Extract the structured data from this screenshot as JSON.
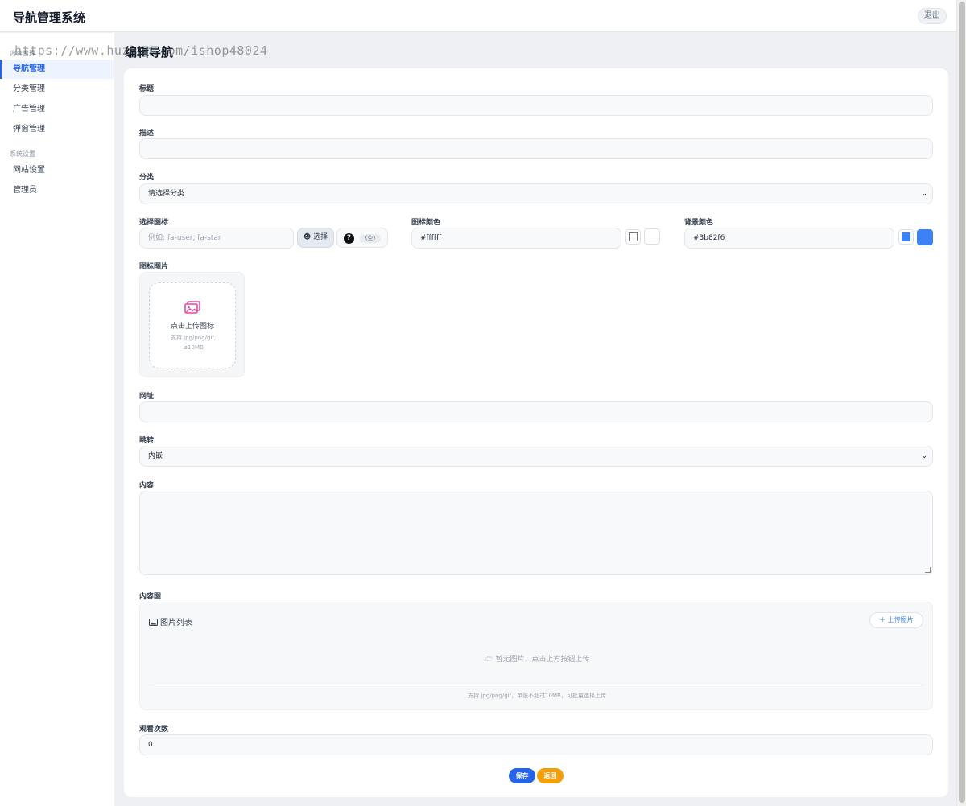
{
  "header": {
    "title": "导航管理系统",
    "logout_label": "退出"
  },
  "sidebar": {
    "group_content": "内容管理",
    "group_system": "系统设置",
    "items": [
      {
        "label": "导航管理",
        "active": true
      },
      {
        "label": "分类管理"
      },
      {
        "label": "广告管理"
      },
      {
        "label": "弹窗管理"
      },
      {
        "label": "网站设置"
      },
      {
        "label": "管理员"
      }
    ]
  },
  "watermark": "https://www.huzhan.com/ishop48024",
  "page_title": "编辑导航",
  "form": {
    "title_label": "标题",
    "title_value": "",
    "desc_label": "描述",
    "desc_value": "",
    "category_label": "分类",
    "category_value": "请选择分类",
    "icon_label": "选择图标",
    "icon_placeholder": "例如: fa-user, fa-star",
    "icon_pick_label": "选择",
    "icon_preview_empty": "(空)",
    "icon_color_label": "图标颜色",
    "icon_color_value": "#ffffff",
    "bg_color_label": "背景颜色",
    "bg_color_value": "#3b82f6",
    "icon_image_label": "图标图片",
    "upload_text": "点击上传图标",
    "upload_hint": "支持 jpg/png/gif, ≤10MB",
    "url_label": "网址",
    "url_value": "",
    "jump_label": "跳转",
    "jump_value": "内嵌",
    "content_label": "内容",
    "content_image_label": "内容图",
    "gallery_title": "图片列表",
    "gallery_upload_label": "上传图片",
    "gallery_empty": "暂无图片，点击上方按钮上传",
    "gallery_note": "支持 jpg/png/gif，单张不超过10MB，可批量选择上传",
    "views_label": "观看次数",
    "views_value": "0",
    "save_label": "保存",
    "back_label": "返回"
  },
  "colors": {
    "accent": "#2563eb",
    "bg_color": "#3b82f6",
    "icon_color": "#ffffff",
    "back_button": "#f59e0b",
    "upload_icon": "#ec4899"
  },
  "icons": [
    "question-icon",
    "smile-icon",
    "image-upload-icon",
    "image-list-icon",
    "plus-icon",
    "folder-open-icon",
    "chevron-down-icon"
  ]
}
